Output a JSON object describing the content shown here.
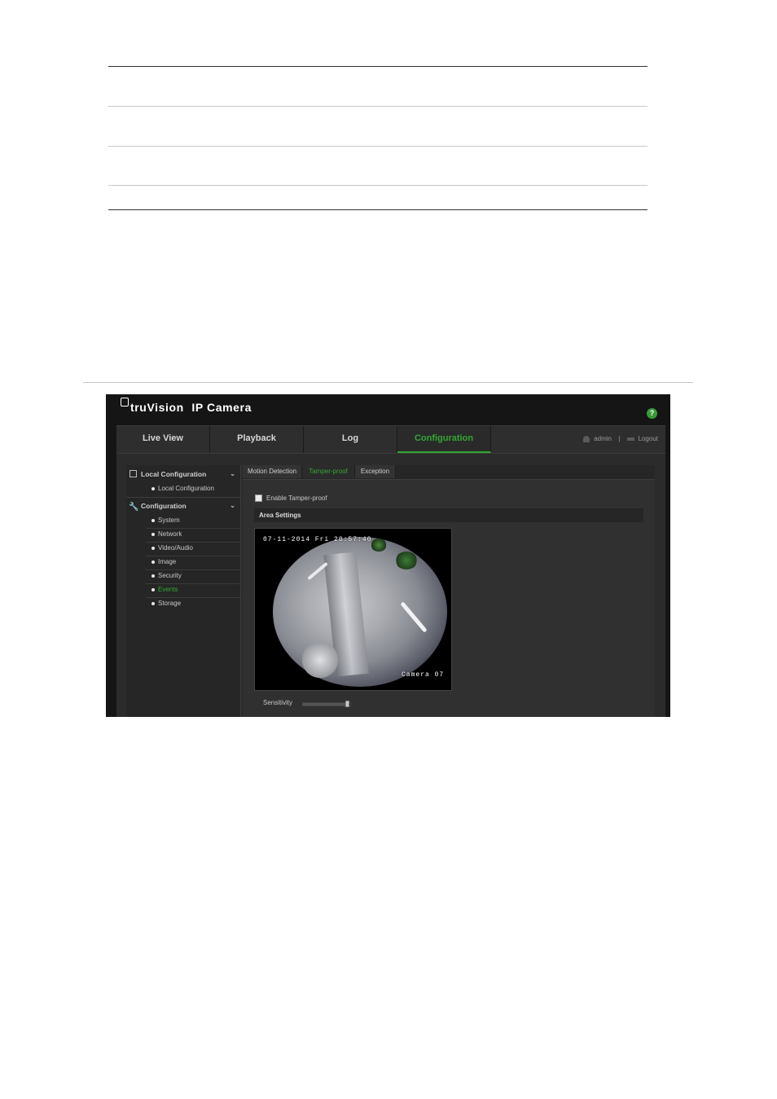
{
  "window": {
    "brand": "truVision",
    "app_title": "IP Camera",
    "help_glyph": "?"
  },
  "nav": {
    "tabs": [
      {
        "label": "Live View",
        "active": false
      },
      {
        "label": "Playback",
        "active": false
      },
      {
        "label": "Log",
        "active": false
      },
      {
        "label": "Configuration",
        "active": true
      }
    ],
    "user": {
      "name": "admin",
      "separator": "|",
      "logout_label": "Logout"
    }
  },
  "sidebar": {
    "sections": [
      {
        "label": "Local Configuration",
        "icon": "local-config-icon",
        "items": [
          {
            "label": "Local Configuration",
            "active": false
          }
        ]
      },
      {
        "label": "Configuration",
        "icon": "wrench-icon",
        "items": [
          {
            "label": "System",
            "active": false
          },
          {
            "label": "Network",
            "active": false
          },
          {
            "label": "Video/Audio",
            "active": false
          },
          {
            "label": "Image",
            "active": false
          },
          {
            "label": "Security",
            "active": false
          },
          {
            "label": "Events",
            "active": true
          },
          {
            "label": "Storage",
            "active": false
          }
        ]
      }
    ]
  },
  "panel": {
    "subtabs": [
      {
        "label": "Motion Detection",
        "active": false
      },
      {
        "label": "Tamper-proof",
        "active": true
      },
      {
        "label": "Exception",
        "active": false
      }
    ],
    "enable_label": "Enable Tamper-proof",
    "enable_checked": false,
    "area_settings_label": "Area Settings",
    "video_osd": {
      "timestamp": "07-11-2014 Fri 20:57:40",
      "camera_name": "Camera 07"
    },
    "sensitivity": {
      "label": "Sensitivity",
      "level": 0.95
    }
  },
  "colors": {
    "accent": "#32a832",
    "background": "#151515"
  }
}
